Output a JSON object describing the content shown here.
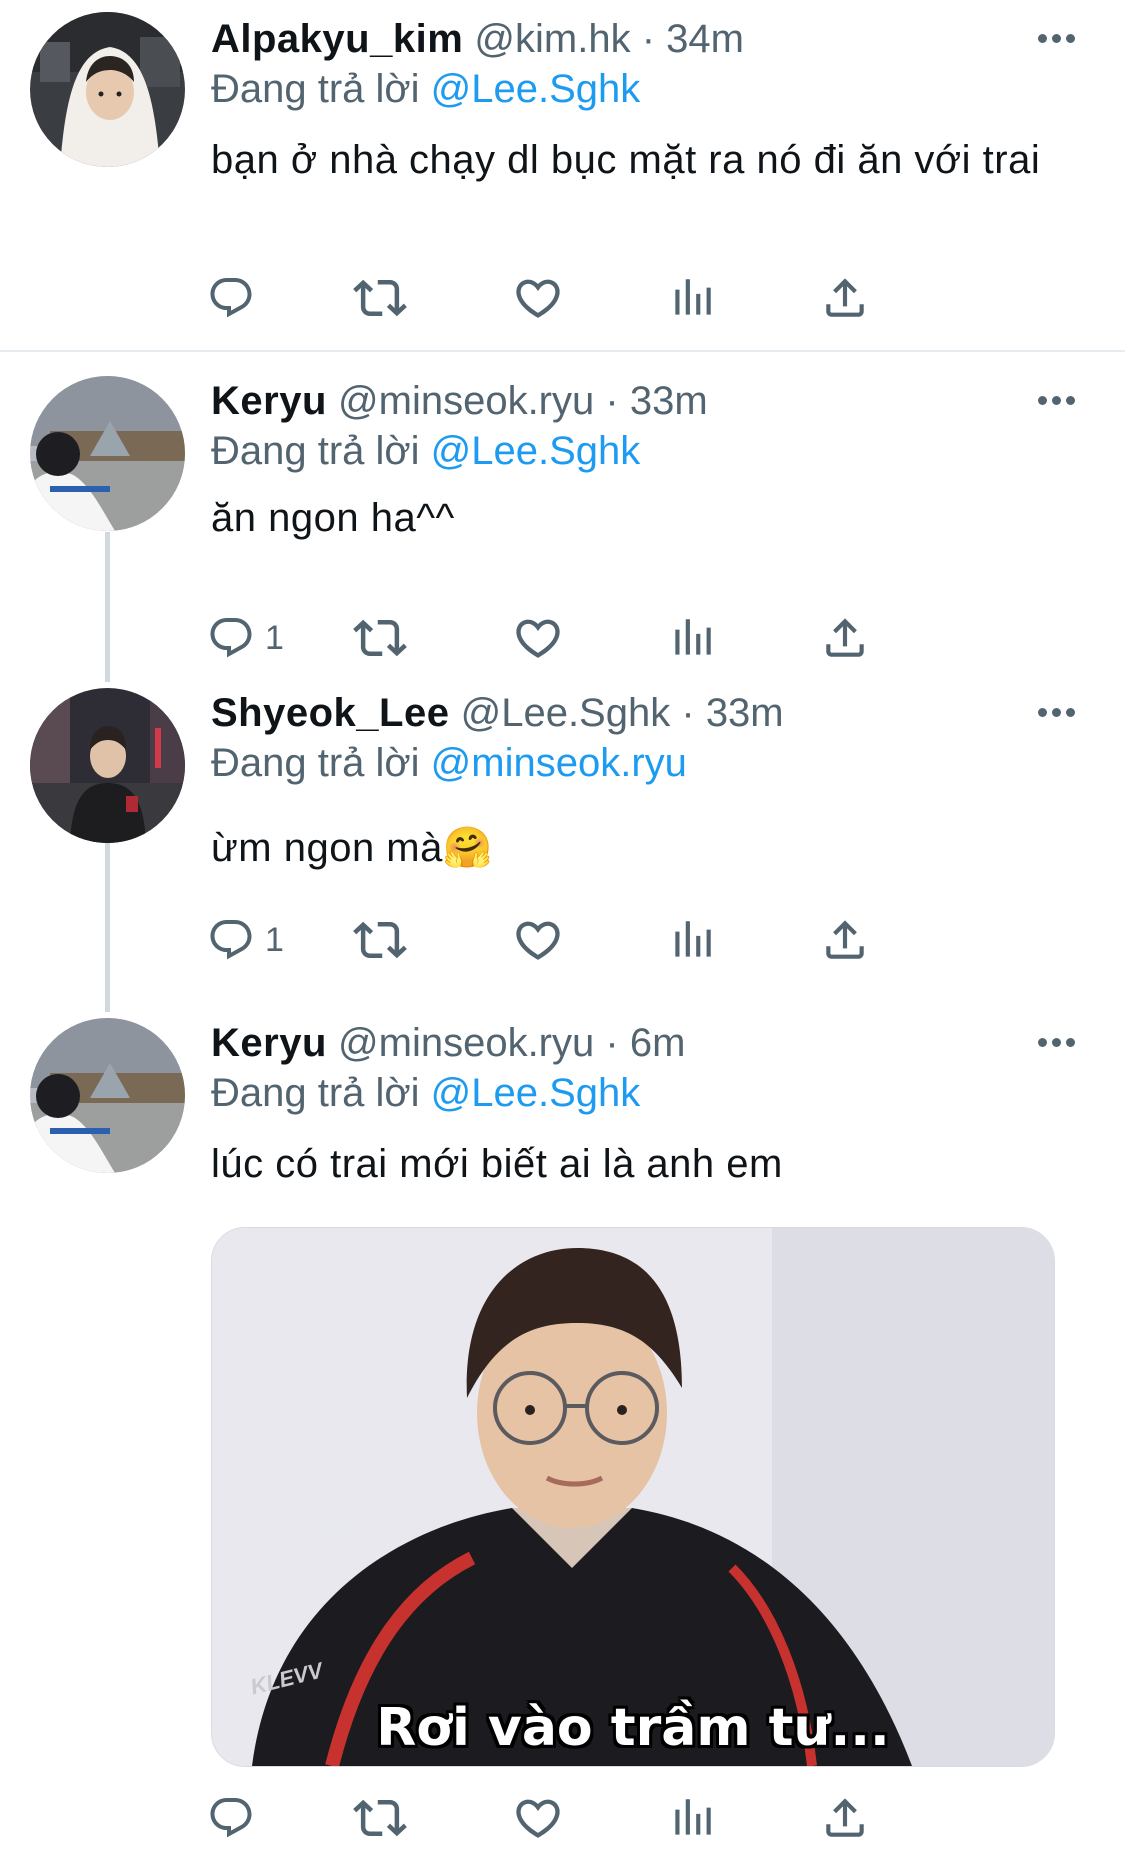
{
  "tweets": [
    {
      "name": "Alpakyu_kim",
      "handle": "@kim.hk",
      "time": "34m",
      "replying_prefix": "Đang trả lời",
      "replying_to": "@Lee.Sghk",
      "text": "bạn ở nhà chạy dl bục mặt ra nó đi ăn với trai",
      "reply_count": "",
      "avatar": "hooded-person-avatar"
    },
    {
      "name": "Keryu",
      "handle": "@minseok.ryu",
      "time": "33m",
      "replying_prefix": "Đang trả lời",
      "replying_to": "@Lee.Sghk",
      "text": "ăn ngon ha^^",
      "reply_count": "1",
      "avatar": "louvre-photo-avatar"
    },
    {
      "name": "Shyeok_Lee",
      "handle": "@Lee.Sghk",
      "time": "33m",
      "replying_prefix": "Đang trả lời",
      "replying_to": "@minseok.ryu",
      "text": "ừm ngon mà",
      "emoji": "🤗",
      "reply_count": "1",
      "avatar": "city-night-photo-avatar"
    },
    {
      "name": "Keryu",
      "handle": "@minseok.ryu",
      "time": "6m",
      "replying_prefix": "Đang trả lời",
      "replying_to": "@Lee.Sghk",
      "text": "lúc có trai mới biết ai là anh em",
      "reply_count": "",
      "avatar": "louvre-photo-avatar",
      "media_caption": "Rơi vào trầm tư...",
      "media_logo": "KLEVV"
    }
  ],
  "separator": "·",
  "icons": [
    "reply-icon",
    "retweet-icon",
    "like-icon",
    "analytics-icon",
    "share-icon",
    "more-icon"
  ],
  "colors": {
    "link": "#1d9bf0",
    "secondary": "#536471",
    "primary_text": "#0f1419",
    "thread_line": "#cfd9de"
  }
}
